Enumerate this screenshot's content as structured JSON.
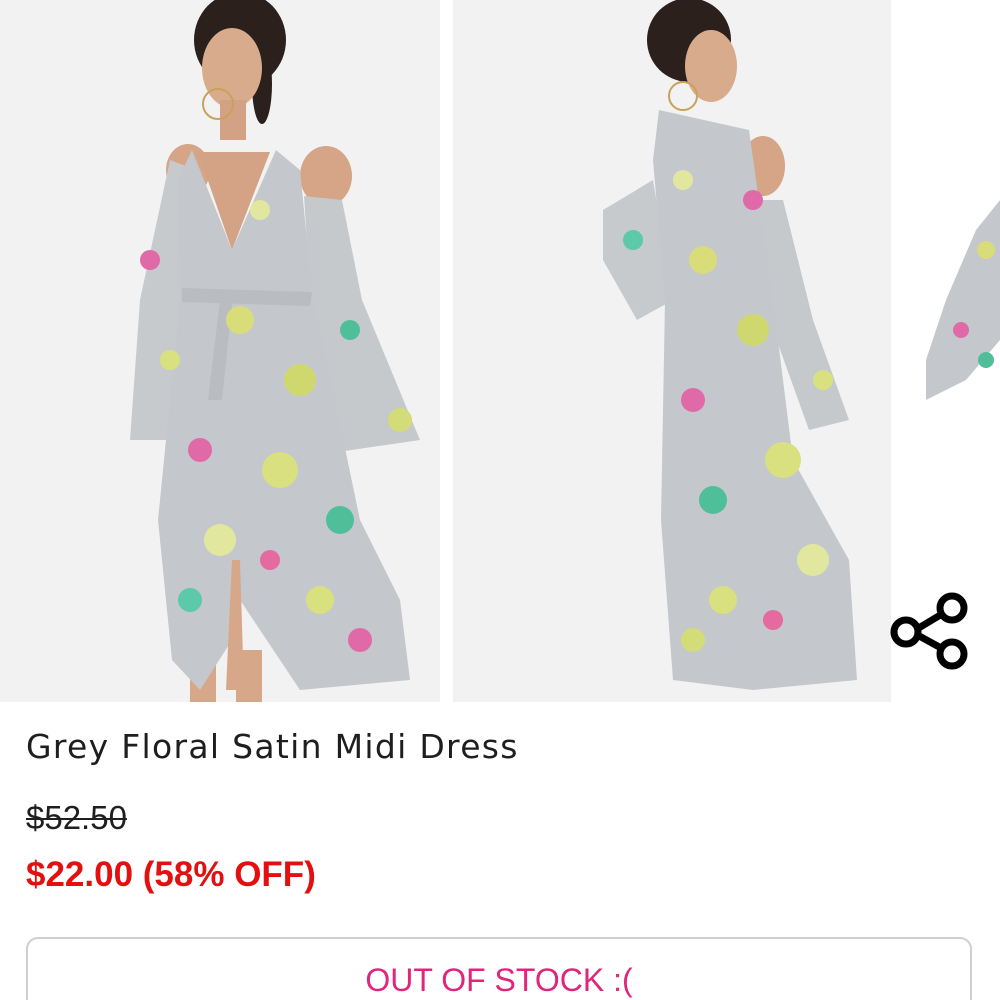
{
  "product": {
    "title": "Grey Floral Satin Midi Dress",
    "original_price": "$52.50",
    "sale_price": "$22.00 (58% OFF)"
  },
  "gallery": {
    "images": [
      "front-view-photo",
      "back-view-photo",
      "side-view-photo-partial"
    ]
  },
  "actions": {
    "stock_status_label": "OUT OF STOCK :(",
    "share_icon": "share-icon"
  },
  "colors": {
    "sale_price": "#e31010",
    "stock_label": "#e0257a",
    "dress_base": "#c4c8cc",
    "text": "#1e1e1e"
  }
}
